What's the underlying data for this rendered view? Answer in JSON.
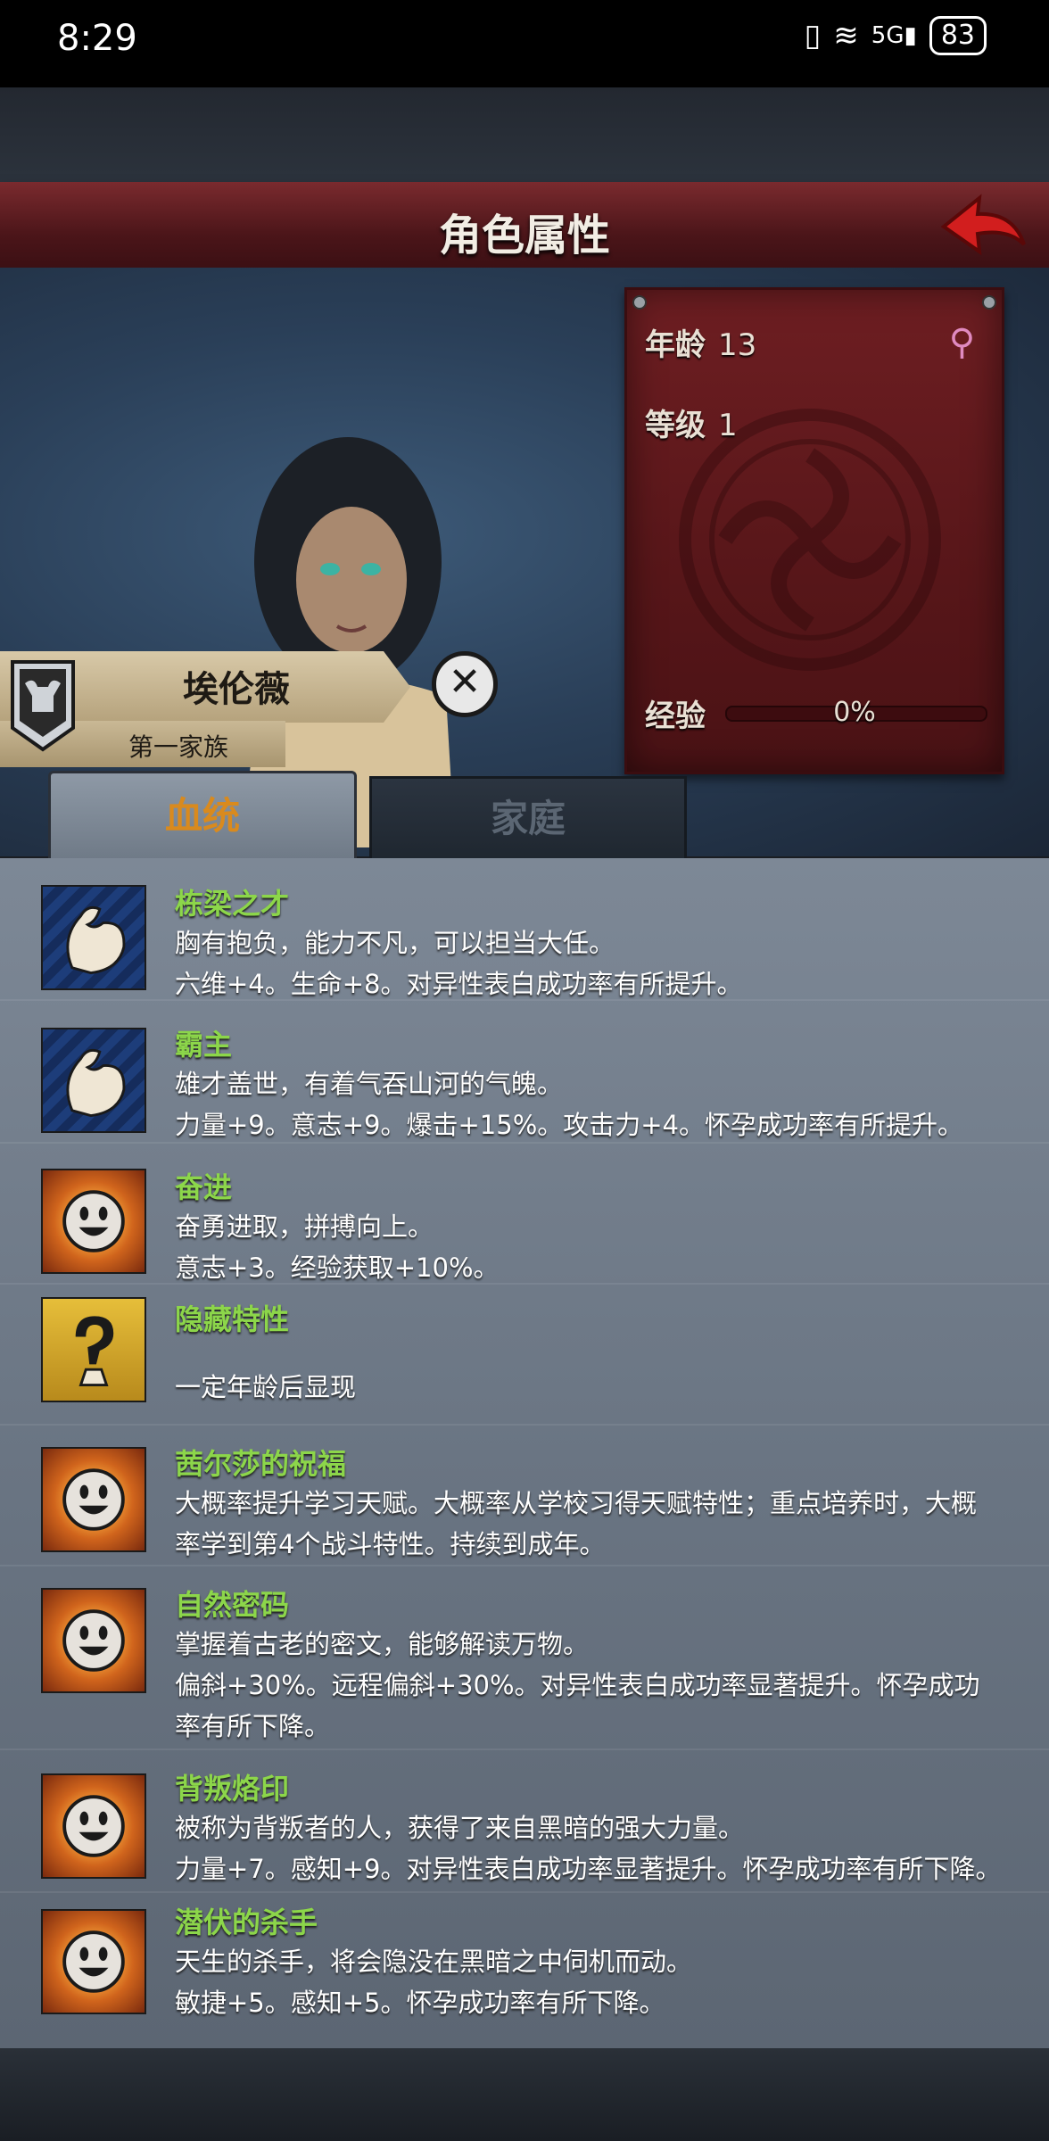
{
  "status_bar": {
    "time": "8:29",
    "battery": "83",
    "network": "5G"
  },
  "header": {
    "title": "角色属性"
  },
  "stats": {
    "age_label": "年龄",
    "age_value": "13",
    "level_label": "等级",
    "level_value": "1",
    "exp_label": "经验",
    "exp_value": "0%",
    "exp_fraction": 0,
    "gender_icon": "female-icon"
  },
  "character": {
    "name": "埃伦薇",
    "family": "第一家族"
  },
  "tabs": [
    {
      "label": "血统",
      "active": true
    },
    {
      "label": "家庭",
      "active": false
    }
  ],
  "traits": [
    {
      "icon": "muscle-icon",
      "name": "栋梁之才",
      "desc1": "胸有抱负，能力不凡，可以担当大任。",
      "desc2": "六维+4。生命+8。对异性表白成功率有所提升。"
    },
    {
      "icon": "muscle-icon",
      "name": "霸主",
      "desc1": "雄才盖世，有着气吞山河的气魄。",
      "desc2": "力量+9。意志+9。爆击+15%。攻击力+4。怀孕成功率有所提升。"
    },
    {
      "icon": "smile-icon",
      "name": "奋进",
      "desc1": "奋勇进取，拼搏向上。",
      "desc2": "意志+3。经验获取+10%。"
    },
    {
      "icon": "question-icon",
      "name": "隐藏特性",
      "desc1": "",
      "desc2": "一定年龄后显现"
    },
    {
      "icon": "smile-icon",
      "name": "茜尔莎的祝福",
      "desc1": "大概率提升学习天赋。大概率从学校习得天赋特性；重点培养时，大概",
      "desc2": "率学到第4个战斗特性。持续到成年。"
    },
    {
      "icon": "smile-icon",
      "name": "自然密码",
      "desc1": "掌握着古老的密文，能够解读万物。",
      "desc2": "偏斜+30%。远程偏斜+30%。对异性表白成功率显著提升。怀孕成功",
      "desc3": "率有所下降。"
    },
    {
      "icon": "smile-icon",
      "name": "背叛烙印",
      "desc1": "被称为背叛者的人，获得了来自黑暗的强大力量。",
      "desc2": "力量+7。感知+9。对异性表白成功率显著提升。怀孕成功率有所下降。"
    },
    {
      "icon": "smile-icon",
      "name": "潜伏的杀手",
      "desc1": "天生的杀手，将会隐没在黑暗之中伺机而动。",
      "desc2": "敏捷+5。感知+5。怀孕成功率有所下降。"
    }
  ],
  "colors": {
    "header": "#5a1a1e",
    "trait_name": "#8cd64a",
    "tab_active_text": "#d98a1e",
    "stats_panel": "#5a161a"
  }
}
